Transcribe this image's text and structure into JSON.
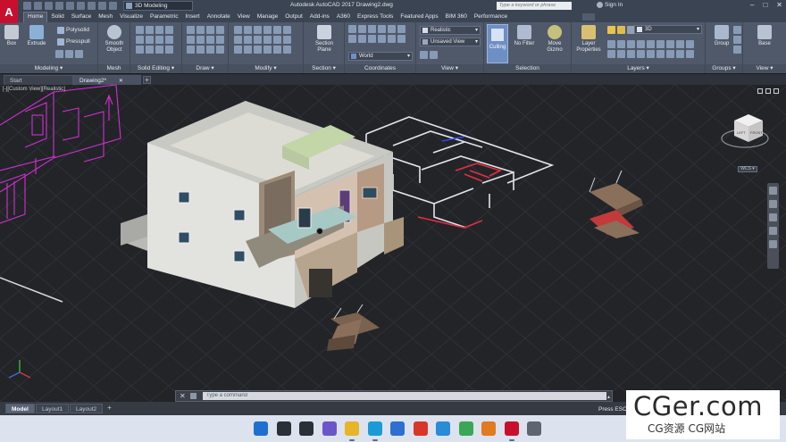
{
  "window": {
    "app_logo": "A",
    "title": "Autodesk AutoCAD 2017    Drawing2.dwg",
    "workspace": "3D Modeling",
    "search_placeholder": "Type a keyword or phrase",
    "sign_in": "Sign In",
    "controls": [
      "–",
      "□",
      "✕"
    ]
  },
  "ribbon_tabs": [
    "Home",
    "Solid",
    "Surface",
    "Mesh",
    "Visualize",
    "Parametric",
    "Insert",
    "Annotate",
    "View",
    "Manage",
    "Output",
    "Add-ins",
    "A360",
    "Express Tools",
    "Featured Apps",
    "BIM 360",
    "Performance"
  ],
  "ribbon": {
    "modeling": {
      "label": "Modeling ▾",
      "box": "Box",
      "extrude": "Extrude",
      "polysolid": "Polysolid",
      "presspull": "Presspull"
    },
    "mesh": {
      "label": "Mesh",
      "smooth_object": "Smooth Object"
    },
    "solid_editing": {
      "label": "Solid Editing ▾"
    },
    "draw": {
      "label": "Draw ▾"
    },
    "modify": {
      "label": "Modify ▾"
    },
    "section": {
      "label": "Section ▾",
      "section_plane": "Section Plane"
    },
    "coordinates": {
      "label": "Coordinates",
      "ucs_value": "World"
    },
    "view": {
      "label": "View ▾",
      "visual_style": "Realistic",
      "named_view": "Unsaved View"
    },
    "selection": {
      "label": "Selection",
      "culling": "Culling",
      "no_filter": "No Filter",
      "move_gizmo": "Move Gizmo"
    },
    "layers": {
      "label": "Layers ▾",
      "layer_properties": "Layer Properties",
      "current_layer": "3D"
    },
    "groups": {
      "label": "Groups ▾",
      "group": "Group"
    },
    "view2": {
      "label": "View ▾",
      "base": "Base"
    }
  },
  "file_tabs": [
    {
      "label": "Start"
    },
    {
      "label": "Drawing2*"
    }
  ],
  "file_tab_close": "✕",
  "add_tab": "+",
  "viewport": {
    "controls_label": "[-][Custom View][Realistic]",
    "wcs_label": "WCS ▾",
    "viewcube": {
      "left": "LEFT",
      "front": "FRONT"
    }
  },
  "command_line": {
    "close": "✕",
    "placeholder": "Type a command",
    "scroll": "▴"
  },
  "layout_tabs": [
    "Model",
    "Layout1",
    "Layout2"
  ],
  "status_text": "Press ESC",
  "watermark": {
    "title": "CGer.com",
    "subtitle": "CG资源  CG网站"
  },
  "taskbar_icons": [
    {
      "name": "windows-start-icon",
      "color": "#1f6fd1"
    },
    {
      "name": "search-icon",
      "color": "#2b2f36"
    },
    {
      "name": "task-view-icon",
      "color": "#2b2f36"
    },
    {
      "name": "teams-chat-icon",
      "color": "#6b56c9"
    },
    {
      "name": "file-explorer-icon",
      "color": "#e7b528"
    },
    {
      "name": "edge-browser-icon",
      "color": "#1a9bd7"
    },
    {
      "name": "store-icon",
      "color": "#2f6fd1"
    },
    {
      "name": "app-red-icon",
      "color": "#d9362b"
    },
    {
      "name": "vscode-icon",
      "color": "#2a8bd6"
    },
    {
      "name": "chrome-icon",
      "color": "#3aa757"
    },
    {
      "name": "app-orange-icon",
      "color": "#e07b22"
    },
    {
      "name": "autocad-icon",
      "color": "#c8102e"
    },
    {
      "name": "app-gray-icon",
      "color": "#5f6570"
    }
  ]
}
